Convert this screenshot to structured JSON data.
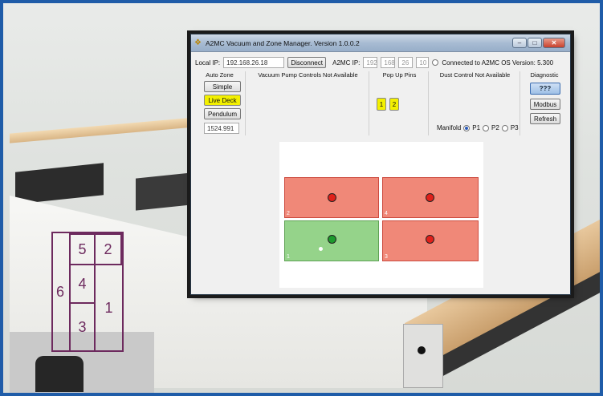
{
  "window": {
    "title": "A2MC Vacuum and Zone Manager.  Version 1.0.0.2",
    "min": "–",
    "max": "□",
    "close": "✕"
  },
  "toolbar": {
    "local_ip_label": "Local IP:",
    "local_ip_value": "192.168.26.18",
    "disconnect_label": "Disconnect",
    "a2mc_ip_label": "A2MC IP:",
    "a2mc_ip_octets": [
      "192",
      "168",
      "26",
      "10"
    ],
    "connection_status": "Connected to A2MC OS Version: 5.300"
  },
  "auto_zone": {
    "title": "Auto Zone",
    "simple_label": "Simple",
    "live_deck_label": "Live Deck",
    "pendulum_label": "Pendulum",
    "value": "1524.991"
  },
  "vacuum": {
    "title": "Vacuum Pump Controls Not Available"
  },
  "popup_pins": {
    "title": "Pop Up Pins",
    "pins": [
      "1",
      "2"
    ]
  },
  "dust": {
    "title": "Dust Control Not Available",
    "manifold_label": "Manifold",
    "options": [
      "P1",
      "P2",
      "P3"
    ],
    "selected": "P1"
  },
  "diagnostic": {
    "title": "Diagnostic",
    "unknown_label": "???",
    "modbus_label": "Modbus",
    "refresh_label": "Refresh"
  },
  "zones": [
    {
      "num": "2",
      "state": "red"
    },
    {
      "num": "4",
      "state": "red"
    },
    {
      "num": "1",
      "state": "green"
    },
    {
      "num": "3",
      "state": "red"
    }
  ],
  "background_diagram": {
    "cells": [
      "5",
      "2",
      "6",
      "4",
      "1",
      "3"
    ]
  },
  "colors": {
    "zone_on": "#95d38a",
    "zone_off": "#f08878",
    "highlight": "#f3f000",
    "frame_border": "#1f5ca8"
  }
}
